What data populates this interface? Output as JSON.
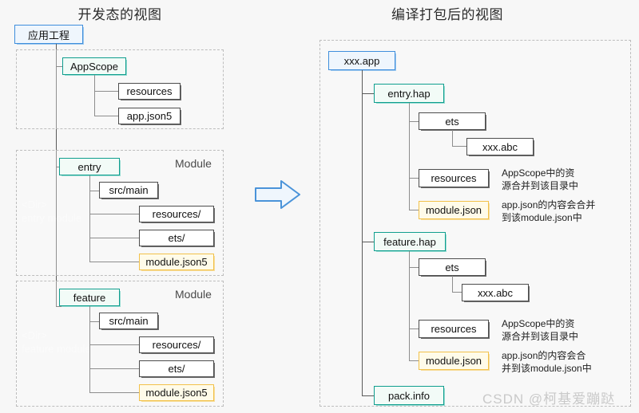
{
  "panels": {
    "left": {
      "title": "开发态的视图",
      "root": {
        "label": "应用工程"
      },
      "groups": [
        {
          "label": "",
          "dim_note": "",
          "nodes": [
            {
              "label": "AppScope"
            },
            {
              "label": "resources"
            },
            {
              "label": "app.json5"
            }
          ]
        },
        {
          "label": "Module",
          "dim_note": "<Dir>\nentry module",
          "nodes": [
            {
              "label": "entry"
            },
            {
              "label": "src/main"
            },
            {
              "label": "resources/"
            },
            {
              "label": "ets/"
            },
            {
              "label": "module.json5"
            }
          ]
        },
        {
          "label": "Module",
          "dim_note": "<Dir>\nfeature module",
          "nodes": [
            {
              "label": "feature"
            },
            {
              "label": "src/main"
            },
            {
              "label": "resources/"
            },
            {
              "label": "ets/"
            },
            {
              "label": "module.json5"
            }
          ]
        }
      ]
    },
    "right": {
      "title": "编译打包后的视图",
      "root": {
        "label": "xxx.app"
      },
      "haps": [
        {
          "label": "entry.hap",
          "children": [
            {
              "label": "ets"
            },
            {
              "label": "xxx.abc"
            },
            {
              "label": "resources"
            },
            {
              "label": "module.json"
            }
          ],
          "annotations": [
            "AppScope中的资\n源合并到该目录中",
            "app.json的内容会合并\n到该module.json中"
          ]
        },
        {
          "label": "feature.hap",
          "children": [
            {
              "label": "ets"
            },
            {
              "label": "xxx.abc"
            },
            {
              "label": "resources"
            },
            {
              "label": "module.json"
            }
          ],
          "annotations": [
            "AppScope中的资\n源合并到该目录中",
            "app.json的内容会合\n并到该module.json中"
          ]
        }
      ],
      "pack_info": {
        "label": "pack.info"
      }
    }
  },
  "arrow": {
    "name": "right-arrow",
    "color": "#3f8edc",
    "fill": "#eff6fd"
  },
  "watermark": "CSDN @柯基爱蹦跶",
  "colors": {
    "blue_border": "#3f8edc",
    "teal_border": "#0f9e8e",
    "yellow_border": "#f2c14a",
    "plain_border": "#4d4d4d",
    "background": "#f7f7f7"
  }
}
